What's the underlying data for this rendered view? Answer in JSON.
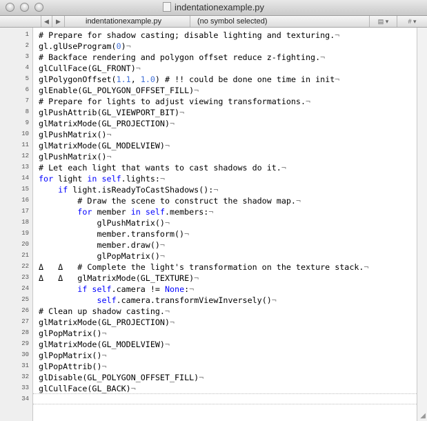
{
  "window": {
    "title": "indentationexample.py"
  },
  "navbar": {
    "back": "◀",
    "forward": "▶",
    "file": "indentationexample.py",
    "symbol": "(no symbol selected)",
    "hash": "#"
  },
  "lines": [
    {
      "n": "1",
      "segs": [
        [
          "cm",
          "# Prepare for shadow casting; disable lighting and texturing."
        ]
      ]
    },
    {
      "n": "2",
      "segs": [
        [
          "",
          "gl.glUseProgram("
        ],
        [
          "num",
          "0"
        ],
        [
          "",
          ")"
        ]
      ]
    },
    {
      "n": "3",
      "segs": [
        [
          "cm",
          "# Backface rendering and polygon offset reduce z-fighting."
        ]
      ]
    },
    {
      "n": "4",
      "segs": [
        [
          "",
          "glCullFace(GL_FRONT)"
        ]
      ]
    },
    {
      "n": "5",
      "segs": [
        [
          "",
          "glPolygonOffset("
        ],
        [
          "num",
          "1.1"
        ],
        [
          "",
          ", "
        ],
        [
          "num",
          "1.0"
        ],
        [
          "",
          ") # !! could be done one time in init"
        ]
      ]
    },
    {
      "n": "6",
      "segs": [
        [
          "",
          "glEnable(GL_POLYGON_OFFSET_FILL)"
        ]
      ]
    },
    {
      "n": "7",
      "segs": [
        [
          "cm",
          "# Prepare for lights to adjust viewing transformations."
        ]
      ]
    },
    {
      "n": "8",
      "segs": [
        [
          "",
          "glPushAttrib(GL_VIEWPORT_BIT)"
        ]
      ]
    },
    {
      "n": "9",
      "segs": [
        [
          "",
          "glMatrixMode(GL_PROJECTION)"
        ]
      ]
    },
    {
      "n": "10",
      "segs": [
        [
          "",
          "glPushMatrix()"
        ]
      ]
    },
    {
      "n": "11",
      "segs": [
        [
          "",
          "glMatrixMode(GL_MODELVIEW)"
        ]
      ]
    },
    {
      "n": "12",
      "segs": [
        [
          "",
          "glPushMatrix()"
        ]
      ]
    },
    {
      "n": "13",
      "segs": [
        [
          "cm",
          "# Let each light that wants to cast shadows do it."
        ]
      ]
    },
    {
      "n": "14",
      "segs": [
        [
          "kw",
          "for"
        ],
        [
          "",
          " light "
        ],
        [
          "kw",
          "in"
        ],
        [
          "",
          " "
        ],
        [
          "kw",
          "self"
        ],
        [
          "",
          ".lights:"
        ]
      ]
    },
    {
      "n": "15",
      "segs": [
        [
          "",
          "    "
        ],
        [
          "kw",
          "if"
        ],
        [
          "",
          " light.isReadyToCastShadows():"
        ]
      ]
    },
    {
      "n": "16",
      "segs": [
        [
          "",
          "        # Draw the scene to construct the shadow map."
        ]
      ]
    },
    {
      "n": "17",
      "segs": [
        [
          "",
          "        "
        ],
        [
          "kw",
          "for"
        ],
        [
          "",
          " member "
        ],
        [
          "kw",
          "in"
        ],
        [
          "",
          " "
        ],
        [
          "kw",
          "self"
        ],
        [
          "",
          ".members:"
        ]
      ]
    },
    {
      "n": "18",
      "segs": [
        [
          "",
          "            glPushMatrix()"
        ]
      ]
    },
    {
      "n": "19",
      "segs": [
        [
          "",
          "            member.transform()"
        ]
      ]
    },
    {
      "n": "20",
      "segs": [
        [
          "",
          "            member.draw()"
        ]
      ]
    },
    {
      "n": "21",
      "segs": [
        [
          "",
          "            glPopMatrix()"
        ]
      ]
    },
    {
      "n": "22",
      "segs": [
        [
          "",
          "Δ   Δ   # Complete the light's transformation on the texture stack."
        ]
      ]
    },
    {
      "n": "23",
      "segs": [
        [
          "",
          "Δ   Δ   glMatrixMode(GL_TEXTURE)"
        ]
      ]
    },
    {
      "n": "24",
      "segs": [
        [
          "",
          "        "
        ],
        [
          "kw",
          "if"
        ],
        [
          "",
          " "
        ],
        [
          "kw",
          "self"
        ],
        [
          "",
          ".camera != "
        ],
        [
          "kw",
          "None"
        ],
        [
          "",
          ":"
        ]
      ]
    },
    {
      "n": "25",
      "segs": [
        [
          "",
          "            "
        ],
        [
          "kw",
          "self"
        ],
        [
          "",
          ".camera.transformViewInversely()"
        ]
      ]
    },
    {
      "n": "26",
      "segs": [
        [
          "cm",
          "# Clean up shadow casting."
        ]
      ]
    },
    {
      "n": "27",
      "segs": [
        [
          "",
          "glMatrixMode(GL_PROJECTION)"
        ]
      ]
    },
    {
      "n": "28",
      "segs": [
        [
          "",
          "glPopMatrix()"
        ]
      ]
    },
    {
      "n": "29",
      "segs": [
        [
          "",
          "glMatrixMode(GL_MODELVIEW)"
        ]
      ]
    },
    {
      "n": "30",
      "segs": [
        [
          "",
          "glPopMatrix()"
        ]
      ]
    },
    {
      "n": "31",
      "segs": [
        [
          "",
          "glPopAttrib()"
        ]
      ]
    },
    {
      "n": "32",
      "segs": [
        [
          "",
          "glDisable(GL_POLYGON_OFFSET_FILL)"
        ]
      ]
    },
    {
      "n": "33",
      "segs": [
        [
          "",
          "glCullFace(GL_BACK)"
        ]
      ]
    },
    {
      "n": "34",
      "segs": []
    }
  ],
  "pilcrow": "¬"
}
